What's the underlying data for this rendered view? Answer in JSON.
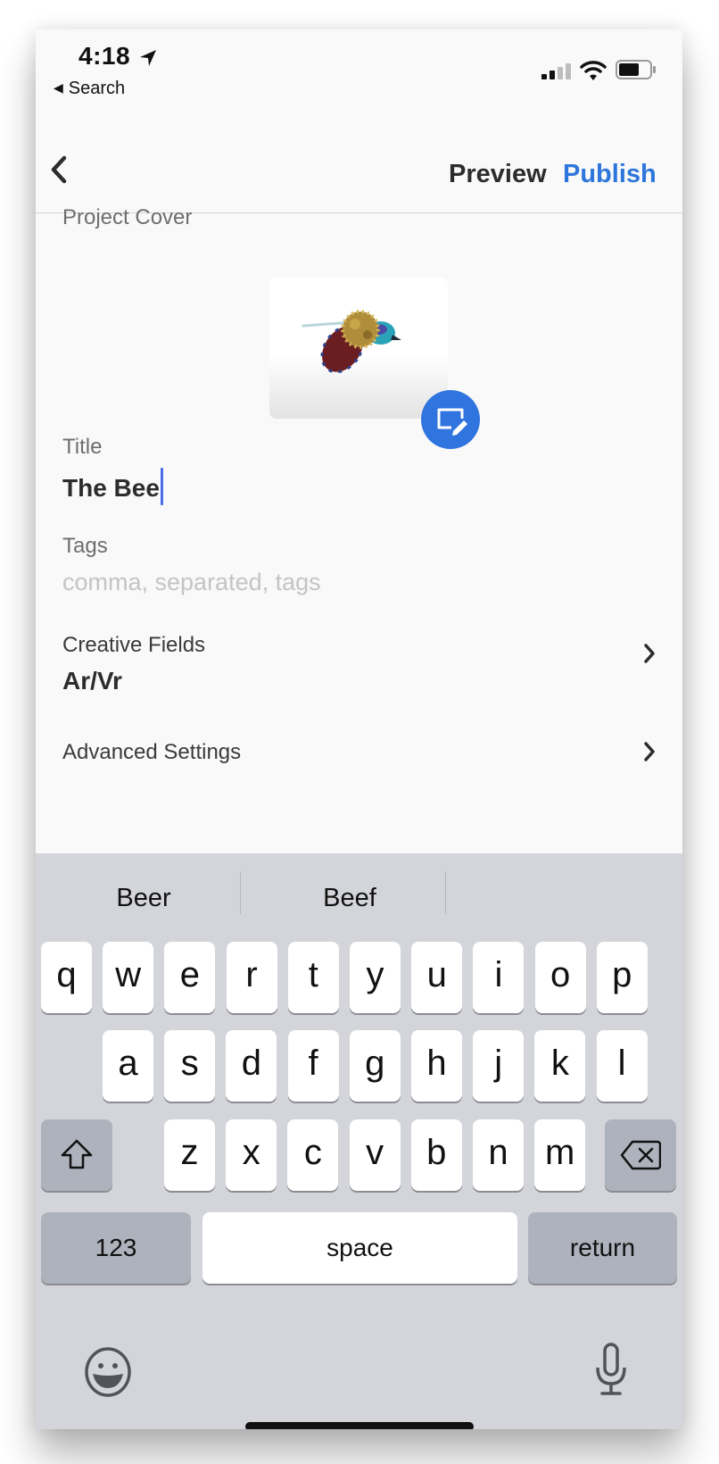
{
  "status_bar": {
    "time": "4:18",
    "back_app_label": "Search",
    "icons": [
      "location-arrow-icon",
      "cellular-signal-icon",
      "wifi-icon",
      "battery-icon"
    ]
  },
  "nav_bar": {
    "back_icon": "chevron-left-icon",
    "preview_label": "Preview",
    "publish_label": "Publish",
    "accent_color": "#2d76db"
  },
  "form": {
    "project_cover_label": "Project Cover",
    "cover_image_alt": "3D bee model",
    "edit_cover_icon": "edit-cover-icon",
    "title_label": "Title",
    "title_value": "The Bee",
    "tags_label": "Tags",
    "tags_placeholder": "comma, separated, tags",
    "creative_fields_label": "Creative Fields",
    "creative_fields_value": "Ar/Vr",
    "advanced_settings_label": "Advanced Settings"
  },
  "keyboard": {
    "suggestions": [
      "Beer",
      "Beef",
      ""
    ],
    "row1": [
      "q",
      "w",
      "e",
      "r",
      "t",
      "y",
      "u",
      "i",
      "o",
      "p"
    ],
    "row2": [
      "a",
      "s",
      "d",
      "f",
      "g",
      "h",
      "j",
      "k",
      "l"
    ],
    "row3": [
      "z",
      "x",
      "c",
      "v",
      "b",
      "n",
      "m"
    ],
    "numbers_label": "123",
    "space_label": "space",
    "return_label": "return",
    "shift_icon": "shift-icon",
    "delete_icon": "backspace-icon",
    "emoji_icon": "emoji-icon",
    "mic_icon": "microphone-icon"
  }
}
